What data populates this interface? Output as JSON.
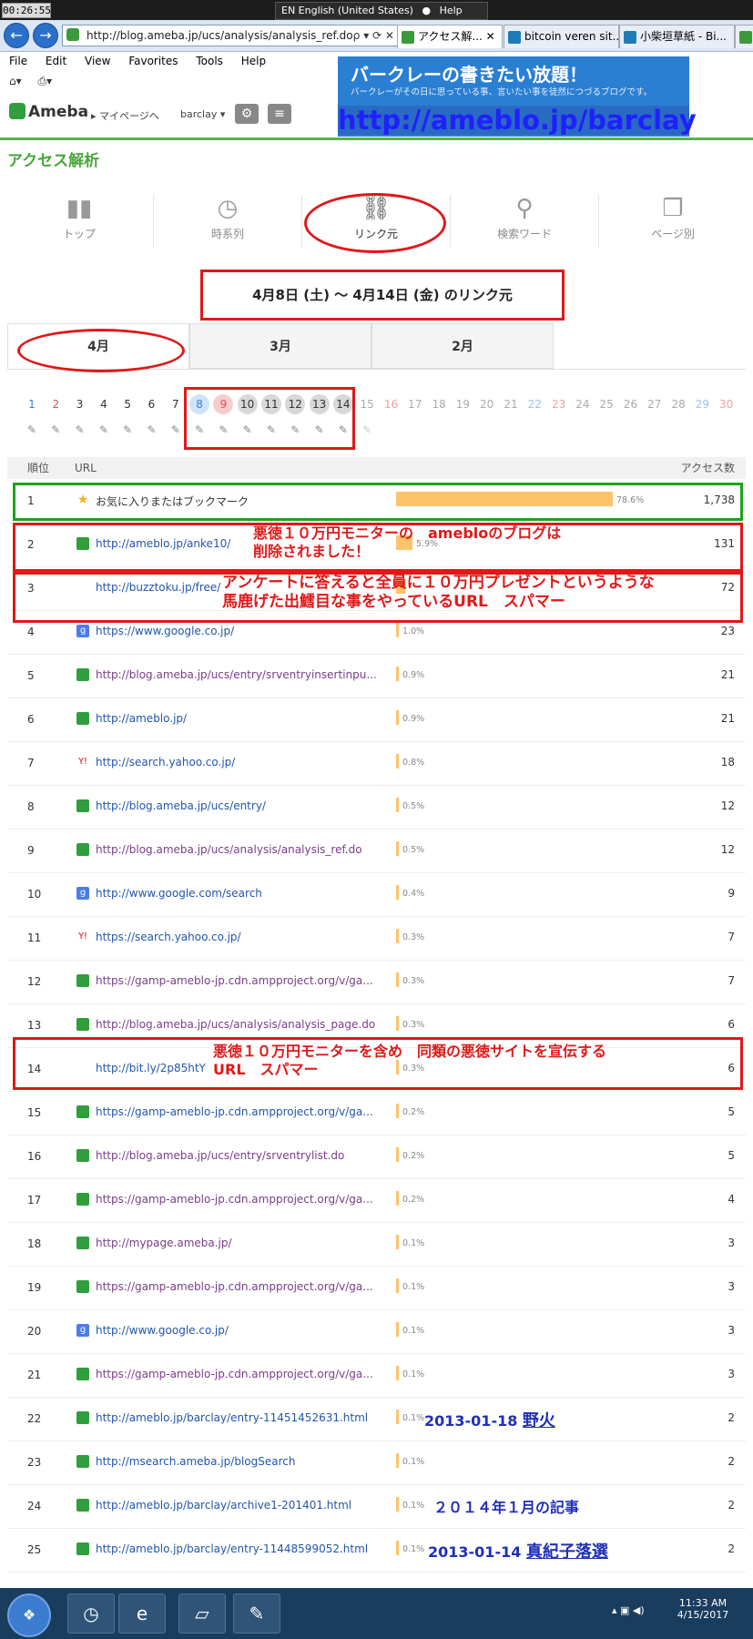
{
  "system": {
    "clock_top": "00:26:55",
    "language": "EN English (United States)",
    "help": "Help"
  },
  "browser": {
    "address": "http://blog.ameba.jp/ucs/analysis/analysis_ref.do",
    "address_tools": "ρ ▾ ⟳ ✕",
    "tabs": [
      "アクセス解...",
      "bitcoin veren sit...",
      "小柴垣草紙 - Bi..."
    ],
    "menu": [
      "File",
      "Edit",
      "View",
      "Favorites",
      "Tools",
      "Help"
    ]
  },
  "banner": {
    "title": "バークレーの書きたい放題！",
    "subtitle": "バークレーがその日に思っている事、言いたい事を徒然につづるブログです。",
    "url": "http://ameblo.jp/barclay"
  },
  "ameba": {
    "logo": "Ameba",
    "mypage": "▸ マイページへ",
    "user": "barclay ▾",
    "page_title": "アクセス解析"
  },
  "nav": {
    "items": [
      {
        "label": "トップ",
        "icon": "bar-chart-icon",
        "glyph": "▮▮"
      },
      {
        "label": "時系列",
        "icon": "clock-icon",
        "glyph": "◷"
      },
      {
        "label": "リンク元",
        "icon": "link-icon",
        "glyph": "⛓"
      },
      {
        "label": "検索ワード",
        "icon": "search-icon",
        "glyph": "⚲"
      },
      {
        "label": "ページ別",
        "icon": "pages-icon",
        "glyph": "❐"
      }
    ]
  },
  "range_title": "4月8日 (土) ～ 4月14日 (金) のリンク元",
  "months": [
    "4月",
    "3月",
    "2月"
  ],
  "days": [
    "1",
    "2",
    "3",
    "4",
    "5",
    "6",
    "7",
    "8",
    "9",
    "10",
    "11",
    "12",
    "13",
    "14",
    "15",
    "16",
    "17",
    "18",
    "19",
    "20",
    "21",
    "22",
    "23",
    "24",
    "25",
    "26",
    "27",
    "28",
    "29",
    "30"
  ],
  "colors": {
    "sat": "#3b7fd6",
    "sun": "#e05050",
    "selected_sat_bg": "#cfe3fb",
    "selected_sun_bg": "#f9cccc",
    "selected_bg": "#d8d8d8",
    "bar": "#fcc46a",
    "green": "#4aa53c",
    "annotation_red": "#e01818"
  },
  "table": {
    "headers": {
      "rank": "順位",
      "url": "URL",
      "count": "アクセス数"
    },
    "rows": [
      {
        "rank": "1",
        "icon": "star-icon",
        "url": "お気に入りまたはブックマーク",
        "pct": "78.6%",
        "share": 0.786,
        "count": "1,738"
      },
      {
        "rank": "2",
        "icon": "ameba-icon",
        "url": "http://ameblo.jp/anke10/",
        "pct": "5.9%",
        "share": 0.059,
        "count": "131"
      },
      {
        "rank": "3",
        "icon": "none",
        "url": "http://buzztoku.jp/free/",
        "pct": "",
        "share": 0.033,
        "count": "72"
      },
      {
        "rank": "4",
        "icon": "google-icon",
        "url": "https://www.google.co.jp/",
        "pct": "1.0%",
        "share": 0.01,
        "count": "23"
      },
      {
        "rank": "5",
        "icon": "ameba-icon",
        "url": "http://blog.ameba.jp/ucs/entry/srventryinsertinpu...",
        "pct": "0.9%",
        "share": 0.009,
        "count": "21"
      },
      {
        "rank": "6",
        "icon": "ameba-icon",
        "url": "http://ameblo.jp/",
        "pct": "0.9%",
        "share": 0.009,
        "count": "21"
      },
      {
        "rank": "7",
        "icon": "yahoo-icon",
        "url": "http://search.yahoo.co.jp/",
        "pct": "0.8%",
        "share": 0.008,
        "count": "18"
      },
      {
        "rank": "8",
        "icon": "ameba-icon",
        "url": "http://blog.ameba.jp/ucs/entry/",
        "pct": "0.5%",
        "share": 0.005,
        "count": "12"
      },
      {
        "rank": "9",
        "icon": "ameba-icon",
        "url": "http://blog.ameba.jp/ucs/analysis/analysis_ref.do",
        "pct": "0.5%",
        "share": 0.005,
        "count": "12"
      },
      {
        "rank": "10",
        "icon": "google-icon",
        "url": "http://www.google.com/search",
        "pct": "0.4%",
        "share": 0.004,
        "count": "9"
      },
      {
        "rank": "11",
        "icon": "yahoo-icon",
        "url": "https://search.yahoo.co.jp/",
        "pct": "0.3%",
        "share": 0.003,
        "count": "7"
      },
      {
        "rank": "12",
        "icon": "ameba-icon",
        "url": "https://gamp-ameblo-jp.cdn.ampproject.org/v/ga...",
        "pct": "0.3%",
        "share": 0.003,
        "count": "7"
      },
      {
        "rank": "13",
        "icon": "ameba-icon",
        "url": "http://blog.ameba.jp/ucs/analysis/analysis_page.do",
        "pct": "0.3%",
        "share": 0.003,
        "count": "6"
      },
      {
        "rank": "14",
        "icon": "none",
        "url": "http://bit.ly/2p85htY",
        "pct": "0.3%",
        "share": 0.003,
        "count": "6"
      },
      {
        "rank": "15",
        "icon": "ameba-icon",
        "url": "https://gamp-ameblo-jp.cdn.ampproject.org/v/ga...",
        "pct": "0.2%",
        "share": 0.002,
        "count": "5"
      },
      {
        "rank": "16",
        "icon": "ameba-icon",
        "url": "http://blog.ameba.jp/ucs/entry/srventrylist.do",
        "pct": "0.2%",
        "share": 0.002,
        "count": "5"
      },
      {
        "rank": "17",
        "icon": "ameba-icon",
        "url": "https://gamp-ameblo-jp.cdn.ampproject.org/v/ga...",
        "pct": "0.2%",
        "share": 0.002,
        "count": "4"
      },
      {
        "rank": "18",
        "icon": "ameba-icon",
        "url": "http://mypage.ameba.jp/",
        "pct": "0.1%",
        "share": 0.001,
        "count": "3"
      },
      {
        "rank": "19",
        "icon": "ameba-icon",
        "url": "https://gamp-ameblo-jp.cdn.ampproject.org/v/ga...",
        "pct": "0.1%",
        "share": 0.001,
        "count": "3"
      },
      {
        "rank": "20",
        "icon": "google-icon",
        "url": "http://www.google.co.jp/",
        "pct": "0.1%",
        "share": 0.001,
        "count": "3"
      },
      {
        "rank": "21",
        "icon": "ameba-icon",
        "url": "https://gamp-ameblo-jp.cdn.ampproject.org/v/ga...",
        "pct": "0.1%",
        "share": 0.001,
        "count": "3"
      },
      {
        "rank": "22",
        "icon": "ameba-icon",
        "url": "http://ameblo.jp/barclay/entry-11451452631.html",
        "pct": "0.1%",
        "share": 0.001,
        "count": "2"
      },
      {
        "rank": "23",
        "icon": "ameba-icon",
        "url": "http://msearch.ameba.jp/blogSearch",
        "pct": "0.1%",
        "share": 0.001,
        "count": "2"
      },
      {
        "rank": "24",
        "icon": "ameba-icon",
        "url": "http://ameblo.jp/barclay/archive1-201401.html",
        "pct": "0.1%",
        "share": 0.001,
        "count": "2"
      },
      {
        "rank": "25",
        "icon": "ameba-icon",
        "url": "http://ameblo.jp/barclay/entry-11448599052.html",
        "pct": "0.1%",
        "share": 0.001,
        "count": "2"
      }
    ]
  },
  "annotations": {
    "row2": "悪徳１０万円モニターの　amebloのブログは\n削除されました！",
    "row3": "アンケートに答えると全員に１０万円プレゼントというような\n馬鹿げた出鱈目な事をやっているURL　スパマー",
    "row14": "悪徳１０万円モニターを含め　同類の悪徳サイトを宣伝する\nURL　スパマー",
    "row22": {
      "date": "2013-01-18",
      "link": "野火"
    },
    "row24": "２０１４年１月の記事",
    "row25": {
      "date": "2013-01-14",
      "link": "真紀子落選"
    }
  },
  "taskbar": {
    "time": "11:33 AM",
    "date": "4/15/2017",
    "tray": "▴ ▣ ◀)"
  }
}
